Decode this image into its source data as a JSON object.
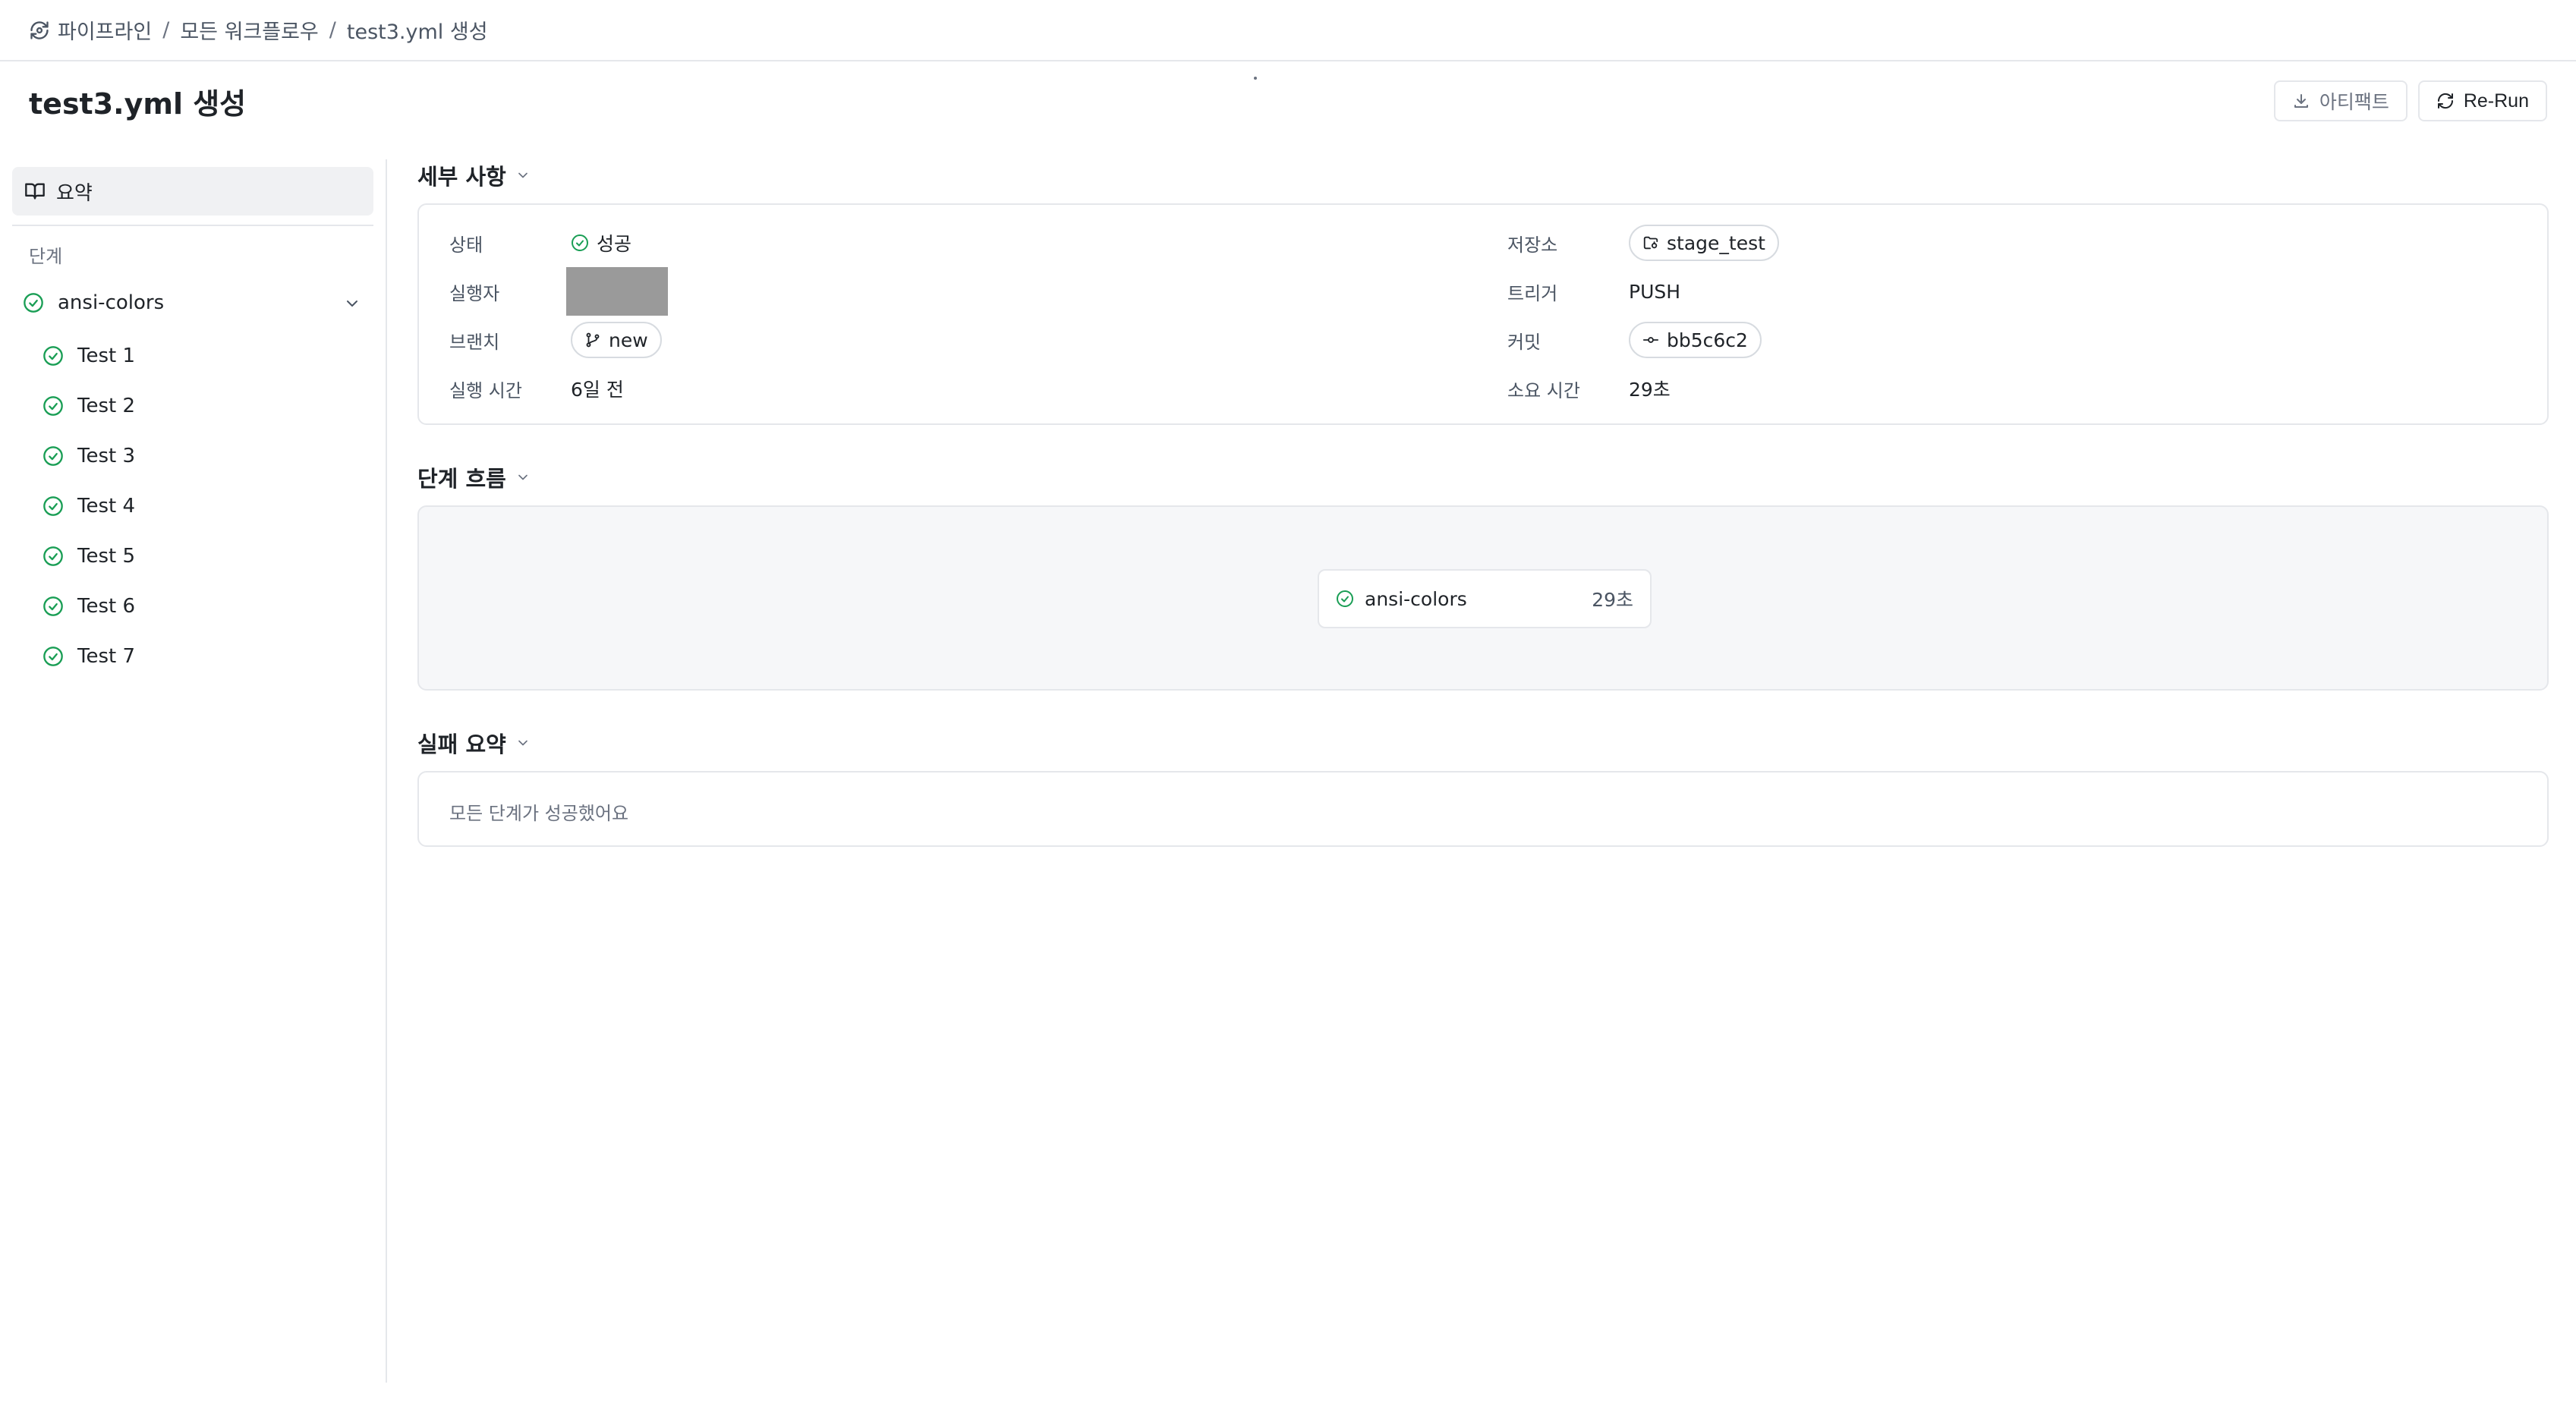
{
  "breadcrumb": {
    "root": "파이프라인",
    "middle": "모든 워크플로우",
    "current": "test3.yml 생성",
    "separator": "/"
  },
  "header": {
    "title": "test3.yml 생성",
    "artifact_label": "아티팩트",
    "rerun_label": "Re-Run"
  },
  "sidebar": {
    "summary_label": "요약",
    "section_label": "단계",
    "job": {
      "name": "ansi-colors",
      "status": "success"
    },
    "steps": [
      {
        "label": "Test 1"
      },
      {
        "label": "Test 2"
      },
      {
        "label": "Test 3"
      },
      {
        "label": "Test 4"
      },
      {
        "label": "Test 5"
      },
      {
        "label": "Test 6"
      },
      {
        "label": "Test 7"
      }
    ]
  },
  "details": {
    "heading": "세부 사항",
    "status_label": "상태",
    "status_value": "성공",
    "runner_label": "실행자",
    "branch_label": "브랜치",
    "branch_value": "new",
    "run_time_label": "실행 시간",
    "run_time_value": "6일 전",
    "repo_label": "저장소",
    "repo_value": "stage_test",
    "trigger_label": "트리거",
    "trigger_value": "PUSH",
    "commit_label": "커밋",
    "commit_value": "bb5c6c2",
    "duration_label": "소요 시간",
    "duration_value": "29초"
  },
  "flow": {
    "heading": "단계 흐름",
    "node_name": "ansi-colors",
    "node_duration": "29초"
  },
  "failure": {
    "heading": "실패 요약",
    "message": "모든 단계가 성공했어요"
  },
  "colors": {
    "success": "#1a9e55",
    "border": "#e5e7eb",
    "sidebar_active_bg": "#f0f1f3",
    "flow_bg": "#f6f7f9"
  }
}
